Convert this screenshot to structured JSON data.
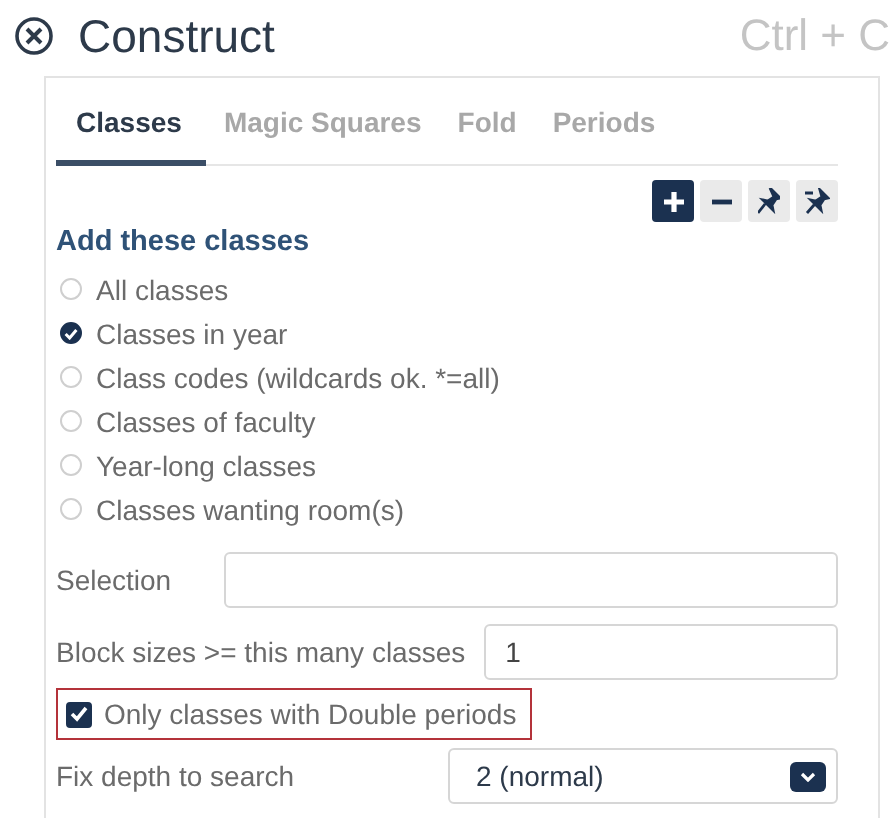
{
  "window": {
    "title": "Construct",
    "shortcut": "Ctrl + C"
  },
  "tabs": [
    {
      "label": "Classes",
      "selected": true
    },
    {
      "label": "Magic Squares",
      "selected": false
    },
    {
      "label": "Fold",
      "selected": false
    },
    {
      "label": "Periods",
      "selected": false
    }
  ],
  "toolbar": [
    {
      "kind": "plus",
      "selected": true
    },
    {
      "kind": "minus",
      "selected": false
    },
    {
      "kind": "pin",
      "selected": false
    },
    {
      "kind": "unpin",
      "selected": false
    }
  ],
  "section_title": "Add these classes",
  "options": [
    {
      "label": "All classes",
      "selected": false
    },
    {
      "label": "Classes in year",
      "selected": true
    },
    {
      "label": "Class codes (wildcards ok. *=all)",
      "selected": false
    },
    {
      "label": "Classes of faculty",
      "selected": false
    },
    {
      "label": "Year-long classes",
      "selected": false
    },
    {
      "label": "Classes wanting room(s)",
      "selected": false
    }
  ],
  "selection": {
    "label": "Selection"
  },
  "block_sizes": {
    "label": "Block sizes >= this many classes",
    "value": "1"
  },
  "double_periods": {
    "label": "Only classes with Double periods",
    "checked": true,
    "highlighted": true
  },
  "fix_depth": {
    "label": "Fix depth to search",
    "value": "2 (normal)"
  }
}
